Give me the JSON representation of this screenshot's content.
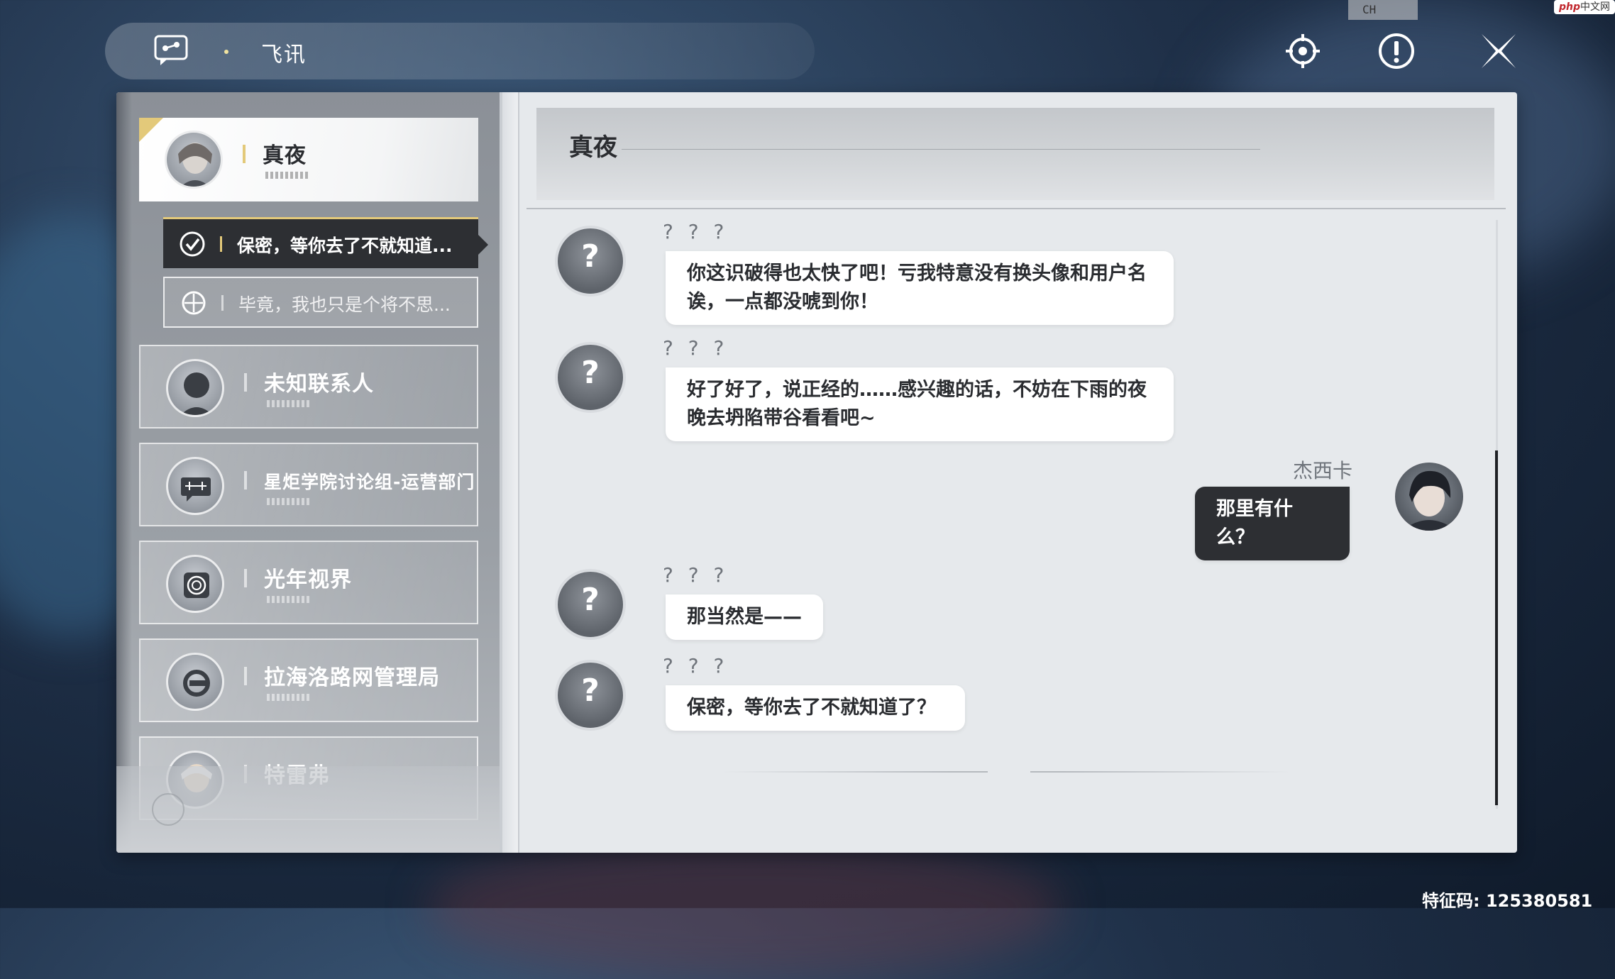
{
  "topbar": {
    "title": "飞讯",
    "icons": [
      "chat-app-icon",
      "settings-target-icon",
      "alert-icon",
      "close-icon"
    ]
  },
  "overlay": {
    "ch_indicator": "CH",
    "watermark_php": "php",
    "watermark_site": "中文网",
    "feature_code": "特征码: 125380581"
  },
  "contacts": [
    {
      "name": "真夜",
      "active": true,
      "avatar": "character-avatar"
    },
    {
      "name": "未知联系人",
      "active": false,
      "avatar": "silhouette-avatar"
    },
    {
      "name": "星炬学院讨论组-运营部门",
      "active": false,
      "avatar": "group-chat-icon"
    },
    {
      "name": "光年视界",
      "active": false,
      "avatar": "spiral-logo-icon"
    },
    {
      "name": "拉海洛路网管理局",
      "active": false,
      "avatar": "agency-logo-icon"
    },
    {
      "name": "特雷弗",
      "active": false,
      "avatar": "character-avatar"
    }
  ],
  "reply_options": [
    {
      "text": "保密，等你去了不就知道...",
      "selected": true
    },
    {
      "text": "毕竟，我也只是个将不思...",
      "selected": false
    }
  ],
  "chat": {
    "title": "真夜",
    "messages": [
      {
        "sender": "? ? ?",
        "text_lines": [
          "你这识破得也太快了吧！亏我特意没有换头像和用户名",
          "诶，一点都没唬到你！"
        ],
        "mine": false
      },
      {
        "sender": "? ? ?",
        "text_lines": [
          "好了好了，说正经的……感兴趣的话，不妨在下雨的夜",
          "晚去坍陷带谷看看吧~"
        ],
        "mine": false
      },
      {
        "sender": "杰西卡",
        "text_lines": [
          "那里有什么？"
        ],
        "mine": true
      },
      {
        "sender": "? ? ?",
        "text_lines": [
          "那当然是——"
        ],
        "mine": false
      },
      {
        "sender": "? ? ?",
        "text_lines": [
          "保密，等你去了不就知道了？"
        ],
        "mine": false
      }
    ],
    "unknown_avatar_glyph": "?"
  },
  "colors": {
    "accent_gold": "#e3c97a",
    "dark_bubble": "#2d2f33",
    "panel_bg": "#e6e9ec"
  }
}
